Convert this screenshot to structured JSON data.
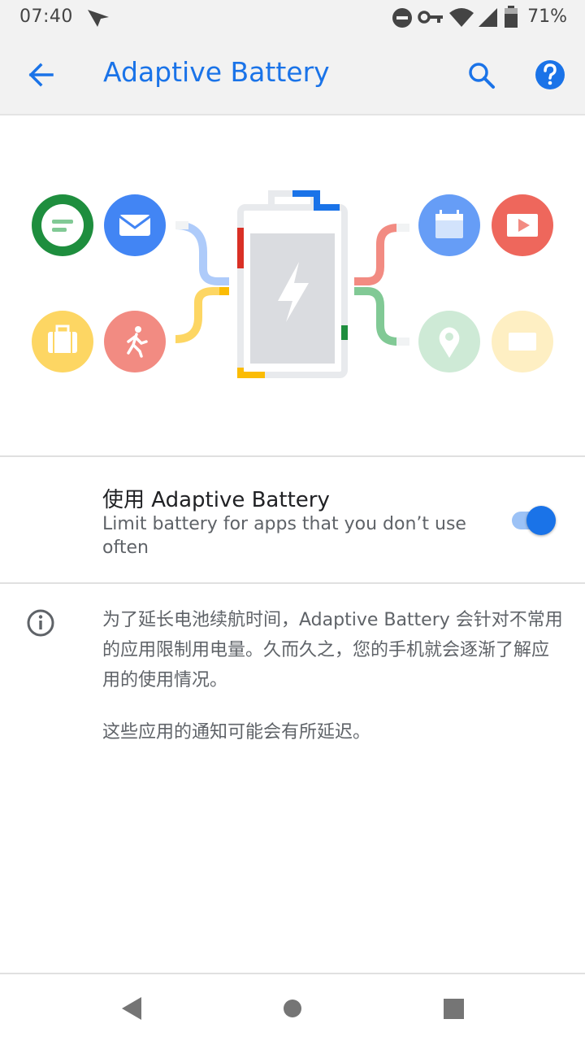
{
  "status_bar": {
    "time": "07:40",
    "battery_percent": "71%",
    "icons": [
      "send-icon",
      "do-not-disturb-icon",
      "vpn-key-icon",
      "wifi-icon",
      "signal-icon",
      "battery-icon"
    ]
  },
  "app_bar": {
    "title": "Adaptive Battery",
    "back_icon": "arrow-back-icon",
    "search_icon": "search-icon",
    "help_icon": "help-icon",
    "accent_color": "#1a73e8"
  },
  "illustration": {
    "app_icons": [
      "message-icon",
      "email-icon",
      "briefcase-icon",
      "walking-icon",
      "calendar-icon",
      "video-play-icon",
      "map-pin-icon",
      "card-icon"
    ],
    "center_icon": "battery-bolt-icon"
  },
  "preference": {
    "title": "使用 Adaptive Battery",
    "summary": "Limit battery for apps that you don’t use often",
    "toggle_on": true
  },
  "info": {
    "icon": "info-icon",
    "text": "为了延长电池续航时间，Adaptive Battery 会针对不常用的应用限制用电量。久而久之，您的手机就会逐渐了解应用的使用情况。",
    "text2": "这些应用的通知可能会有所延迟。"
  },
  "nav_bar": {
    "icons": [
      "back-triangle-icon",
      "home-circle-icon",
      "recents-square-icon"
    ]
  }
}
